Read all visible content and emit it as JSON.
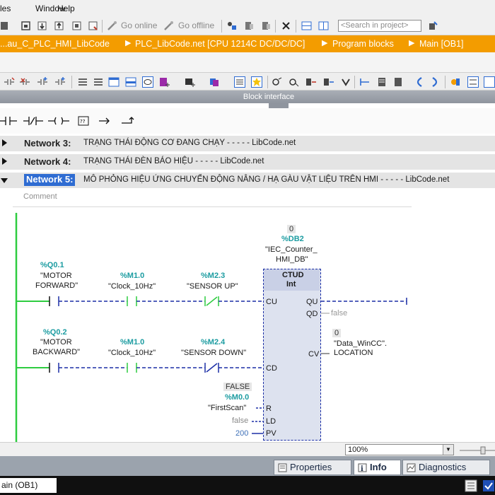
{
  "menu": {
    "items": [
      "les",
      "Window",
      "Help"
    ]
  },
  "toolbar": {
    "go_online": "Go online",
    "go_offline": "Go offline",
    "search_placeholder": "<Search in project>"
  },
  "breadcrumb": {
    "items": [
      "...au_C_PLC_HMI_LibCode",
      "PLC_LibCode.net [CPU 1214C DC/DC/DC]",
      "Program blocks",
      "Main [OB1]"
    ]
  },
  "block_interface": {
    "label": "Block interface"
  },
  "networks": [
    {
      "title": "Network 3:",
      "description": "TRẠNG THÁI ĐỘNG CƠ ĐANG CHẠY - - - - - LibCode.net"
    },
    {
      "title": "Network 4:",
      "description": "TRẠNG THÁI ĐÈN BÁO HIỆU - - - - - LibCode.net"
    },
    {
      "title": "Network 5:",
      "description": "MÔ PHỎNG HIỆU ỨNG CHUYỂN ĐỘNG NÂNG / HẠ GÀU VẬT LIỆU TRÊN HMI - - - - - LibCode.net"
    }
  ],
  "comment_placeholder": "Comment",
  "ladder": {
    "row1": {
      "contact1": {
        "address": "%Q0.1",
        "operand1": "\"MOTOR",
        "operand2": "FORWARD\""
      },
      "contact2": {
        "address": "%M1.0",
        "operand": "\"Clock_10Hz\""
      },
      "contact3": {
        "address": "%M2.3",
        "operand": "\"SENSOR UP\""
      }
    },
    "row2": {
      "contact1": {
        "address": "%Q0.2",
        "operand1": "\"MOTOR",
        "operand2": "BACKWARD\""
      },
      "contact2": {
        "address": "%M1.0",
        "operand": "\"Clock_10Hz\""
      },
      "contact3": {
        "address": "%M2.4",
        "operand": "\"SENSOR DOWN\""
      }
    },
    "counter": {
      "instance_value": "0",
      "instance_address": "%DB2",
      "instance_name1": "\"IEC_Counter_",
      "instance_name2": "HMI_DB\"",
      "type": "CTUD",
      "datatype": "Int",
      "pins": {
        "cu": "CU",
        "cd": "CD",
        "r": "R",
        "ld": "LD",
        "pv": "PV",
        "qu": "QU",
        "qd": "QD",
        "cv": "CV"
      }
    },
    "reset": {
      "value": "FALSE",
      "address": "%M0.0",
      "operand": "\"FirstScan\""
    },
    "load_value": "false",
    "preset_value": "200",
    "qd_value": "false",
    "cv_output": {
      "value": "0",
      "operand1": "\"Data_WinCC\".",
      "operand2": "LOCATION"
    }
  },
  "zoom": {
    "value": "100%"
  },
  "inspector": {
    "tabs": [
      {
        "label": "Properties",
        "active": false
      },
      {
        "label": "Info",
        "active": true
      },
      {
        "label": "Diagnostics",
        "active": false
      }
    ]
  },
  "taskbar": {
    "main_tab": "ain (OB1)"
  },
  "colors": {
    "breadcrumb_bg": "#f39c00",
    "address_teal": "#1c9ca1",
    "power_rail_green": "#2ecc40",
    "dashed_wire_blue": "#1c2fa6",
    "network_highlight": "#2f6cd2"
  }
}
